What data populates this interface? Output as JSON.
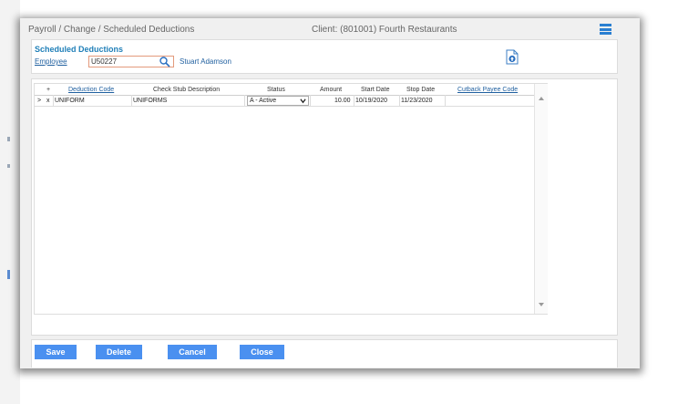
{
  "header": {
    "breadcrumb": "Payroll / Change / Scheduled Deductions",
    "client": "Client: (801001) Fourth Restaurants"
  },
  "employee_section": {
    "title": "Scheduled Deductions",
    "employee_label": "Employee",
    "employee_value": "U50227",
    "employee_name": "Stuart Adamson"
  },
  "grid": {
    "columns": {
      "add": "+",
      "deduction_code": "Deduction Code",
      "check_stub_description": "Check Stub Description",
      "status": "Status",
      "amount": "Amount",
      "start_date": "Start Date",
      "stop_date": "Stop Date",
      "cutback_payee_code": "Cutback Payee Code"
    },
    "rows": [
      {
        "selector": ">",
        "remove": "x",
        "deduction_code": "UNIFORM",
        "check_stub_description": "UNIFORMS",
        "status": "A - Active",
        "amount": "10.00",
        "start_date": "10/19/2020",
        "stop_date": "11/23/2020",
        "cutback_payee_code": ""
      }
    ]
  },
  "actions": {
    "save": "Save",
    "delete": "Delete",
    "cancel": "Cancel",
    "close": "Close"
  },
  "colors": {
    "accent": "#1f7fb8",
    "link": "#1f5f9f",
    "button": "#4a90f0",
    "input_border": "#e39a7c"
  },
  "icons": {
    "menu": "menu-lines-icon",
    "search": "search-icon",
    "document": "document-upload-icon",
    "status_dropdown": "chevron-down-icon"
  }
}
